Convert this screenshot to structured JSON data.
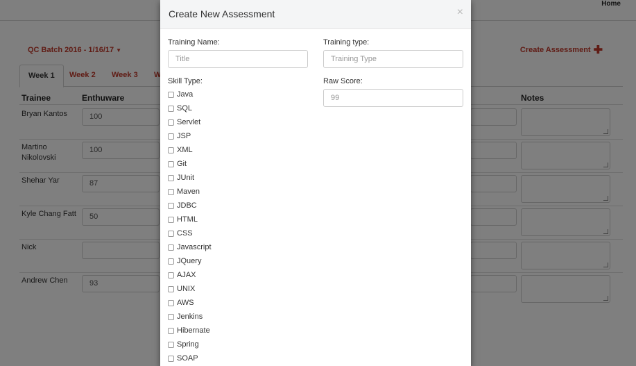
{
  "nav": {
    "home": "Home"
  },
  "batch": {
    "label": "QC Batch 2016 - 1/16/17"
  },
  "create_link": "Create Assessment",
  "tabs": [
    "Week 1",
    "Week 2",
    "Week 3",
    "W"
  ],
  "table": {
    "headers": {
      "trainee": "Trainee",
      "enthuware": "Enthuware",
      "notes": "Notes"
    },
    "rows": [
      {
        "name": "Bryan Kantos",
        "score": "100"
      },
      {
        "name": "Martino Nikolovski",
        "score": "100"
      },
      {
        "name": "Shehar Yar",
        "score": "87"
      },
      {
        "name": "Kyle Chang Fatt",
        "score": "50"
      },
      {
        "name": "Nick",
        "score": ""
      },
      {
        "name": "Andrew Chen",
        "score": "93"
      }
    ]
  },
  "modal": {
    "title": "Create New Assessment",
    "close": "×",
    "training_name_label": "Training Name:",
    "training_name_placeholder": "Title",
    "training_type_label": "Training type:",
    "training_type_placeholder": "Training Type",
    "skill_type_label": "Skill Type:",
    "raw_score_label": "Raw Score:",
    "raw_score_placeholder": "99",
    "skills": [
      "Java",
      "SQL",
      "Servlet",
      "JSP",
      "XML",
      "Git",
      "JUnit",
      "Maven",
      "JDBC",
      "HTML",
      "CSS",
      "Javascript",
      "JQuery",
      "AJAX",
      "UNIX",
      "AWS",
      "Jenkins",
      "Hibernate",
      "Spring",
      "SOAP"
    ]
  },
  "colors": {
    "accent": "#c0392b",
    "overlay": "rgba(0,0,0,0.5)"
  }
}
